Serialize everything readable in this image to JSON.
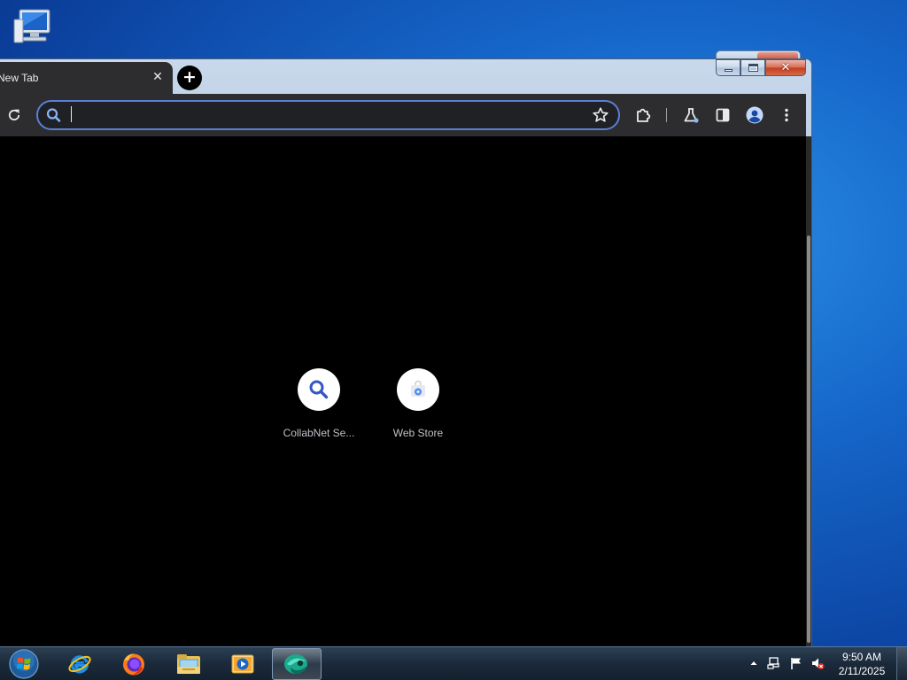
{
  "desktop": {
    "icons": [
      {
        "icon": "computer-icon"
      }
    ]
  },
  "window": {
    "caption_buttons": {
      "minimize": "minimize-icon",
      "maximize": "maximize-icon",
      "close": "close-icon"
    }
  },
  "browser": {
    "tab": {
      "title": "New Tab",
      "close_glyph": "✕"
    },
    "new_tab_glyph": "+",
    "omnibox": {
      "value": "",
      "placeholder": ""
    },
    "toolbar_icons": [
      "reload-icon",
      "bookmark-star-icon",
      "extensions-icon",
      "labs-flask-icon",
      "side-panel-icon",
      "profile-avatar-icon",
      "more-menu-icon"
    ],
    "shortcuts": [
      {
        "label": "CollabNet Se...",
        "icon": "search-icon"
      },
      {
        "label": "Web Store",
        "icon": "web-store-icon"
      }
    ],
    "colors": {
      "accent": "#5b7fd4",
      "toolbar": "#2d2d2f",
      "page_background": "#000000"
    }
  },
  "taskbar": {
    "pinned": [
      {
        "name": "Internet Explorer",
        "icon": "internet-explorer-icon"
      },
      {
        "name": "Firefox",
        "icon": "firefox-icon"
      },
      {
        "name": "File Explorer",
        "icon": "file-explorer-icon"
      },
      {
        "name": "Media Player",
        "icon": "media-player-icon"
      },
      {
        "name": "Browser",
        "icon": "browser-icon",
        "active": true
      }
    ],
    "tray_icons": [
      "show-hidden-icons-icon",
      "network-icon",
      "action-center-flag-icon",
      "volume-muted-icon"
    ],
    "clock": {
      "time": "9:50 AM",
      "date": "2/11/2025"
    }
  }
}
